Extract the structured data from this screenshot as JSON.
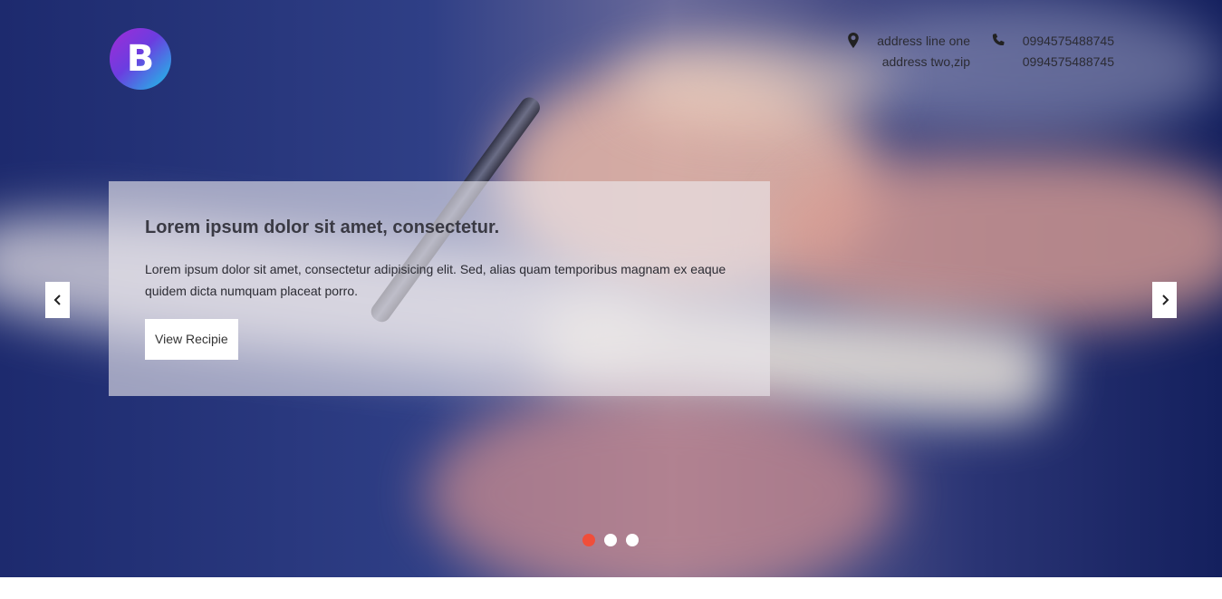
{
  "brand": {
    "logo_letter": "B"
  },
  "contact": {
    "address": {
      "icon": "map-pin-icon",
      "line1": "address line one",
      "line2": "address two,zip"
    },
    "phone": {
      "icon": "phone-icon",
      "line1": "0994575488745",
      "line2": "0994575488745"
    }
  },
  "slide": {
    "title": "Lorem ipsum dolor sit amet, consectetur.",
    "text": "Lorem ipsum dolor sit amet, consectetur adipisicing elit. Sed, alias quam temporibus magnam ex eaque quidem dicta numquam placeat porro.",
    "button_label": "View Recipie"
  },
  "carousel": {
    "prev_icon": "chevron-left-icon",
    "next_icon": "chevron-right-icon",
    "indicators": [
      {
        "active": true
      },
      {
        "active": false
      },
      {
        "active": false
      }
    ],
    "active_color": "#f04e3a"
  }
}
